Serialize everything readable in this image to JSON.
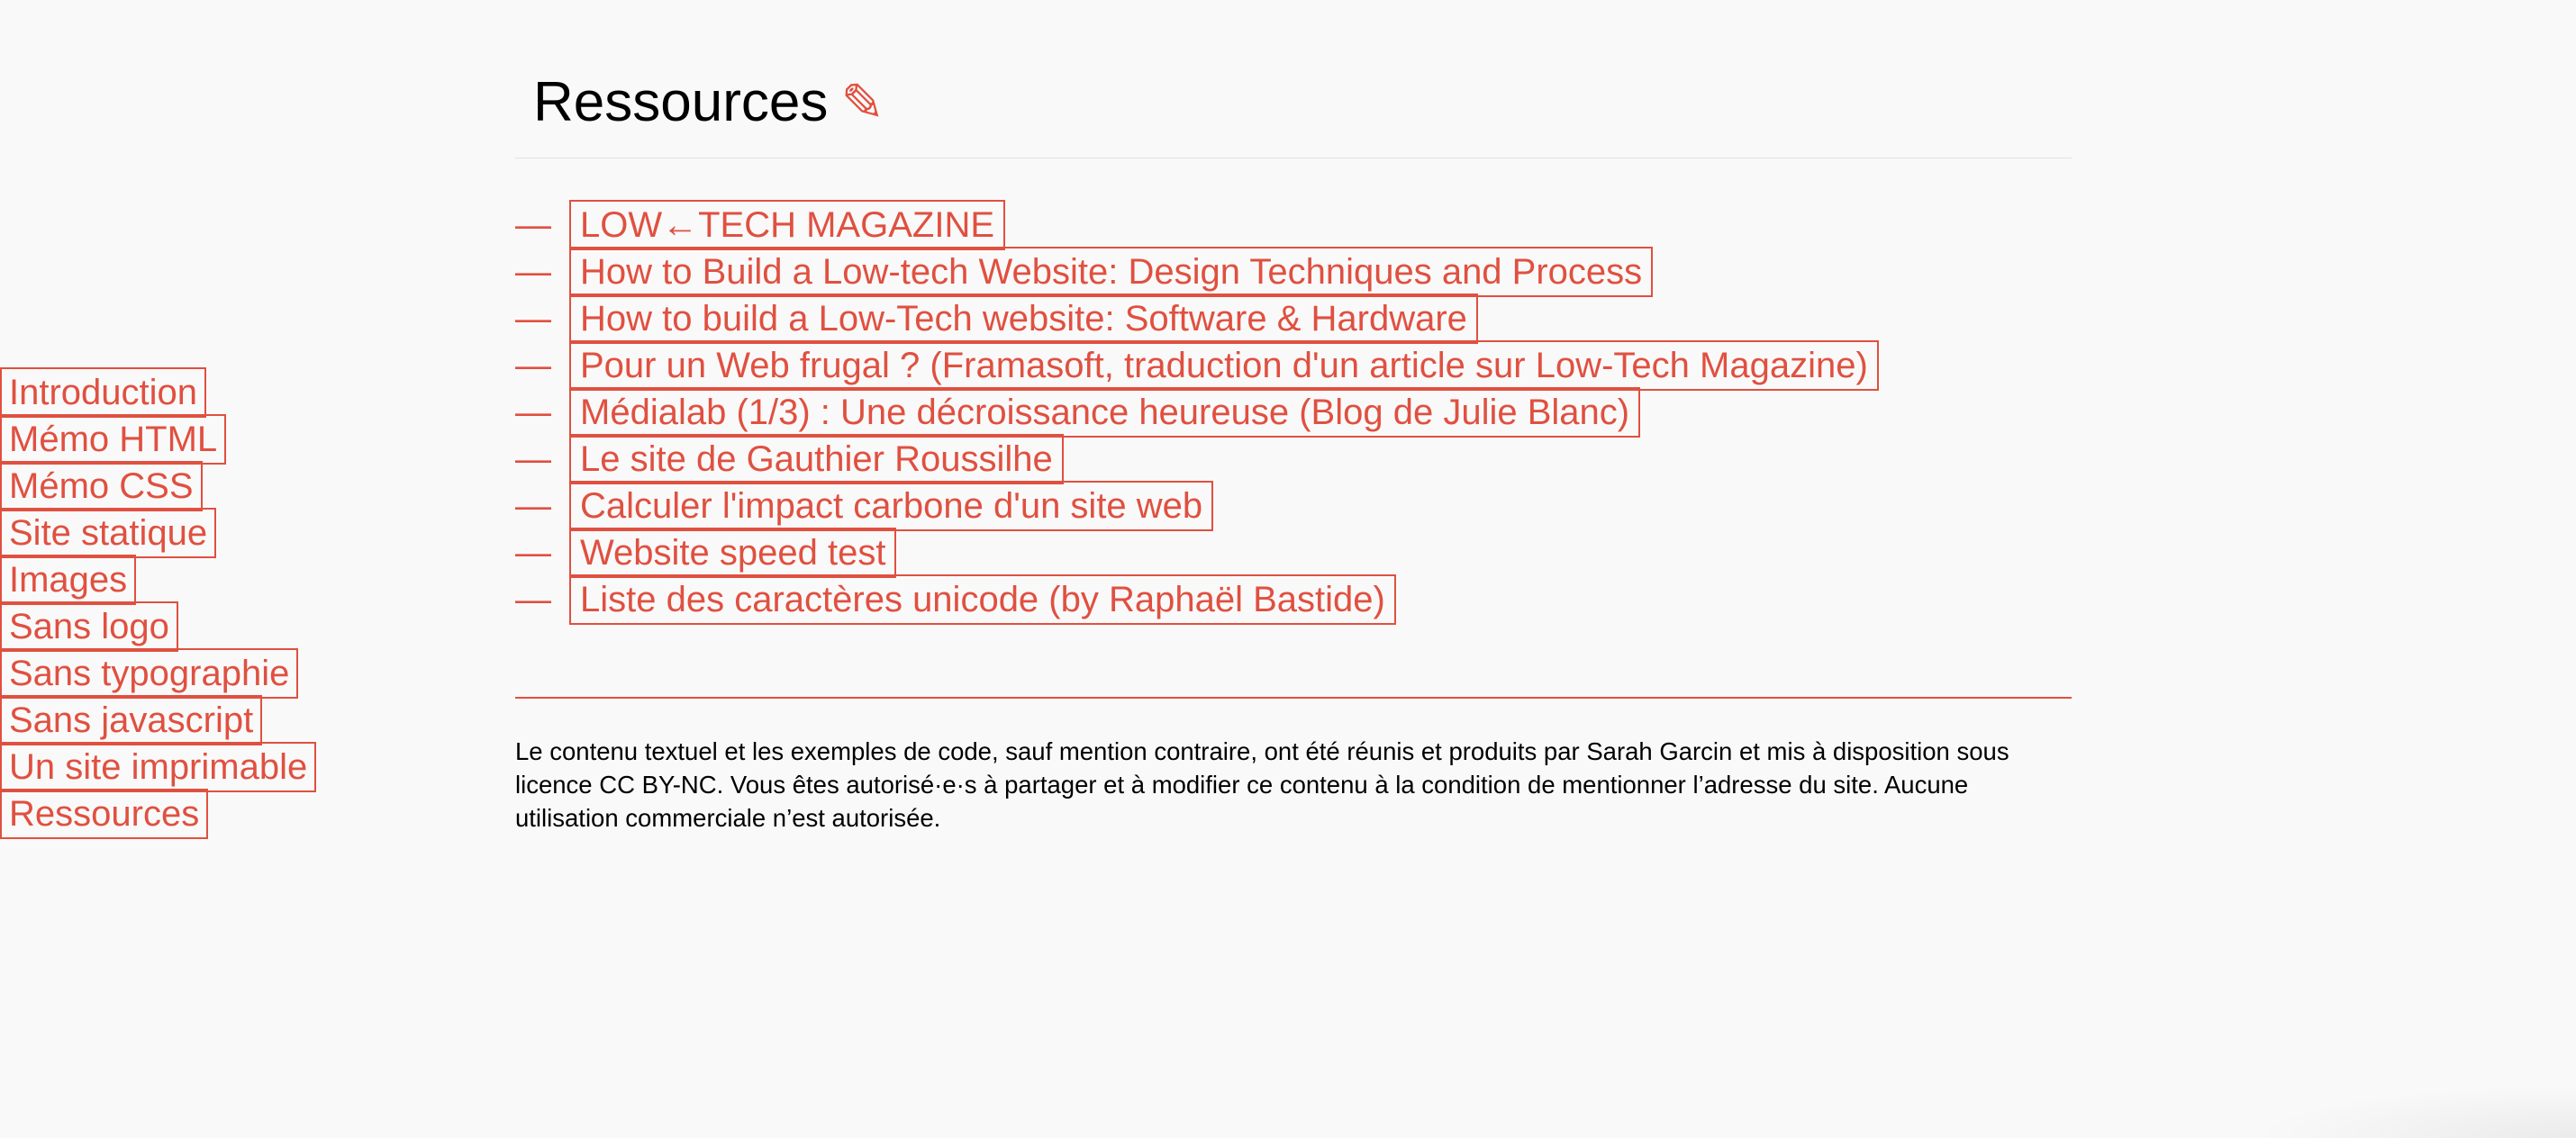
{
  "sidebar": {
    "items": [
      {
        "label": "Introduction"
      },
      {
        "label": "Mémo HTML"
      },
      {
        "label": "Mémo CSS"
      },
      {
        "label": "Site statique"
      },
      {
        "label": "Images"
      },
      {
        "label": "Sans logo"
      },
      {
        "label": "Sans typographie"
      },
      {
        "label": "Sans javascript"
      },
      {
        "label": "Un site imprimable"
      },
      {
        "label": "Ressources"
      }
    ]
  },
  "main": {
    "title": "Ressources",
    "edit_icon": "✎",
    "list_marker": "—",
    "resources": [
      {
        "label": "LOW←TECH MAGAZINE"
      },
      {
        "label": "How to Build a Low-tech Website: Design Techniques and Process"
      },
      {
        "label": "How to build a Low-Tech website: Software & Hardware"
      },
      {
        "label": "Pour un Web frugal ? (Framasoft, traduction d'un article sur Low-Tech Magazine)"
      },
      {
        "label": "Médialab (1/3) : Une décroissance heureuse (Blog de Julie Blanc)"
      },
      {
        "label": "Le site de Gauthier Roussilhe"
      },
      {
        "label": "Calculer l'impact carbone d'un site web"
      },
      {
        "label": "Website speed test"
      },
      {
        "label": "Liste des caractères unicode (by Raphaël Bastide)"
      }
    ]
  },
  "footer": {
    "text": "Le contenu textuel et les exemples de code, sauf mention contraire, ont été réunis et produits par Sarah Garcin et mis à disposition sous licence CC BY-NC. Vous êtes autorisé·e·s à partager et à modifier ce contenu à la condition de mentionner l’adresse du site. Aucune utilisation commerciale n’est autorisée."
  },
  "colors": {
    "accent": "#e05040",
    "background": "#f9f9f9",
    "text": "#000000"
  }
}
